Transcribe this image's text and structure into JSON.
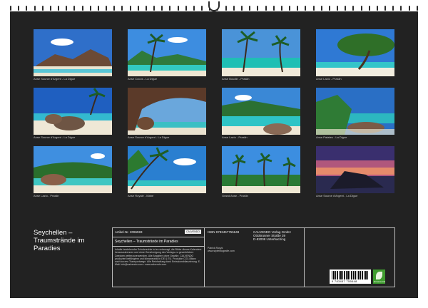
{
  "photos": [
    {
      "caption": "Anse Source d'Argent - La Digue",
      "scene": "granite-rocks-beach"
    },
    {
      "caption": "Anse Cocos - La Digue",
      "scene": "palm-lagoon"
    },
    {
      "caption": "Anse Boudin - Praslin",
      "scene": "palms-turquoise"
    },
    {
      "caption": "Anse Lazio - Praslin",
      "scene": "tree-beach"
    },
    {
      "caption": "Anse Source d'Argent - La Digue",
      "scene": "boulders-sea"
    },
    {
      "caption": "Anse Source d'Argent - La Digue",
      "scene": "rock-arch"
    },
    {
      "caption": "Anse Lazio - Praslin",
      "scene": "bay-rocks"
    },
    {
      "caption": "Anse Patates - La Digue",
      "scene": "green-coast"
    },
    {
      "caption": "Anse Lazio - Praslin",
      "scene": "rocks-jungle"
    },
    {
      "caption": "Anse Royale - Mahé",
      "scene": "leaning-palms"
    },
    {
      "caption": "Grand Anse - Praslin",
      "scene": "palm-line"
    },
    {
      "caption": "Anse Source d'Argent - La Digue",
      "scene": "sunset-rocks"
    }
  ],
  "footer": {
    "title": "Seychellen – Traumstrände im Paradies",
    "article_no": "Artikel-Nr. 2096593",
    "brand": "CALVENDO",
    "subtitle": "Seychellen – Traumstrände im Paradies",
    "description": "Inhalte bestehender Schutzrechte ist es untersagt, die Bilder dieses Kalenders herauszutrennen und ohne Genehmigung des Verlags zu gewerblichen Zwecken weiterzuverwenden. Alle Angaben ohne Gewähr. CALVENDO produziert befähigtem und klimaneutral in DE & EU. Produkte CO2-Bilanz nach kurzen Transportwege. Alle Reinhaltung dank Emissionsbilanzierung. E-Mail: info@calvendo.com • www.calvendo.com",
    "isbn": "ISBN 9783457755648",
    "photographer": "Patrick Rosyk\nwww.stylefotografie.com",
    "publisher": "CALVENDO Verlag GmbH\nOttobrunner Straße 39\nD-82008 Unterhaching",
    "barcode_number": "9 783457 755648",
    "eco_label": "klimaneutral"
  }
}
